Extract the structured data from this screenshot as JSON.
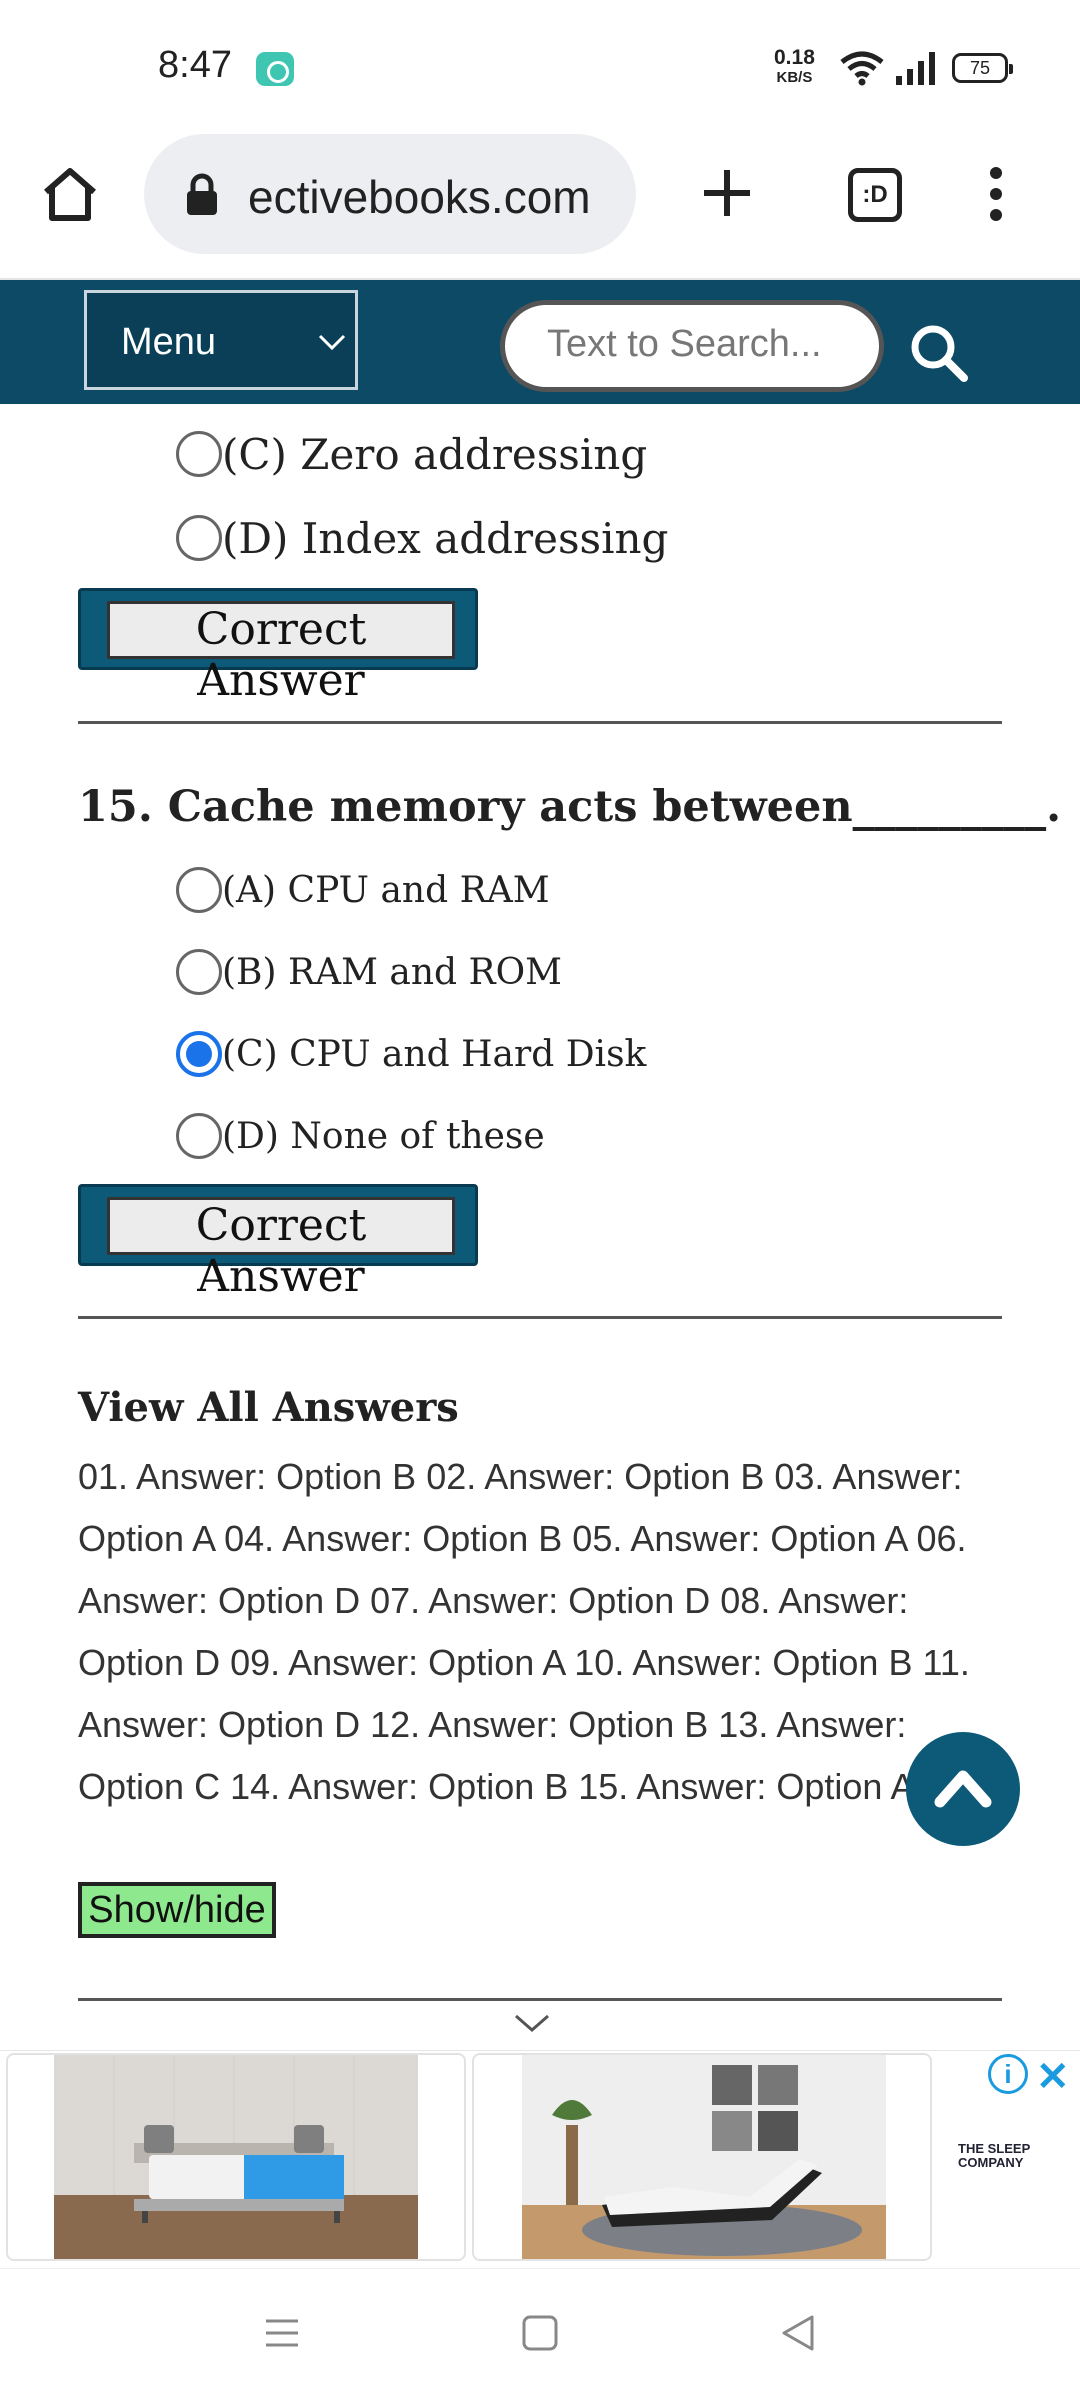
{
  "status_bar": {
    "time": "8:47",
    "net_speed_value": "0.18",
    "net_speed_unit": "KB/S",
    "battery": "75"
  },
  "browser": {
    "url": "ectivebooks.com",
    "tab_icon_text": ":D"
  },
  "site_header": {
    "menu_label": "Menu",
    "search_placeholder": "Text to Search..."
  },
  "prev_question": {
    "options": [
      {
        "label": "(C) Zero addressing"
      },
      {
        "label": "(D) Index addressing"
      }
    ],
    "correct_answer_label": "Correct Answer"
  },
  "question_15": {
    "title": "15. Cache memory acts between_________.",
    "options": [
      {
        "label": "(A) CPU and RAM",
        "checked": false
      },
      {
        "label": "(B) RAM and ROM",
        "checked": false
      },
      {
        "label": "(C) CPU and Hard Disk",
        "checked": true
      },
      {
        "label": "(D) None of these",
        "checked": false
      }
    ],
    "correct_answer_label": "Correct Answer"
  },
  "view_all": {
    "title": "View All Answers",
    "text": "01. Answer: Option B 02. Answer: Option B 03. Answer: Option A 04. Answer: Option B 05. Answer: Option A 06. Answer: Option D 07. Answer: Option D 08. Answer: Option D 09. Answer: Option A 10. Answer: Option B 11. Answer: Option D 12. Answer: Option B 13. Answer: Option C 14. Answer: Option B 15. Answer: Option A",
    "toggle_label": "Show/hide"
  },
  "ad": {
    "brand_line1": "THE SLEEP",
    "brand_line2": "COMPANY",
    "info_label": "i",
    "close_label": "✕"
  },
  "colors": {
    "header_bg": "#0c4a66",
    "button_bg": "#0c5a78",
    "radio_checked": "#1a73e8",
    "toggle_bg": "#8ee88e"
  }
}
